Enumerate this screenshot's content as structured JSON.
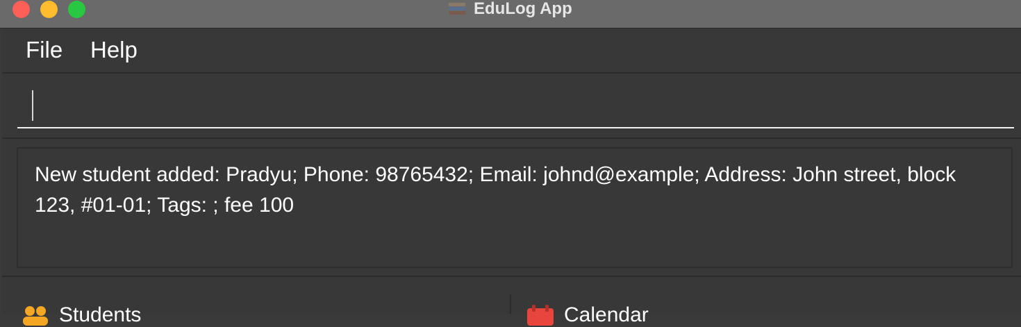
{
  "window": {
    "title": "EduLog App",
    "icon": "books-icon",
    "controls": [
      "close",
      "minimize",
      "maximize"
    ]
  },
  "menu": {
    "items": [
      {
        "label": "File"
      },
      {
        "label": "Help"
      }
    ]
  },
  "command_box": {
    "value": "",
    "placeholder": ""
  },
  "result_display": {
    "text": "New student added: Pradyu; Phone: 98765432; Email: johnd@example; Address: John street, block 123, #01-01; Tags: ; fee 100"
  },
  "tabs": [
    {
      "label": "Students",
      "icon": "students-icon"
    },
    {
      "label": "Calendar",
      "icon": "calendar-icon"
    }
  ],
  "colors": {
    "background": "#383838",
    "titlebar": "#6a6a6a",
    "close": "#fe5f57",
    "minimize": "#febc2e",
    "maximize": "#28c840",
    "students_icon": "#f5a623",
    "calendar_icon": "#e8453c"
  }
}
